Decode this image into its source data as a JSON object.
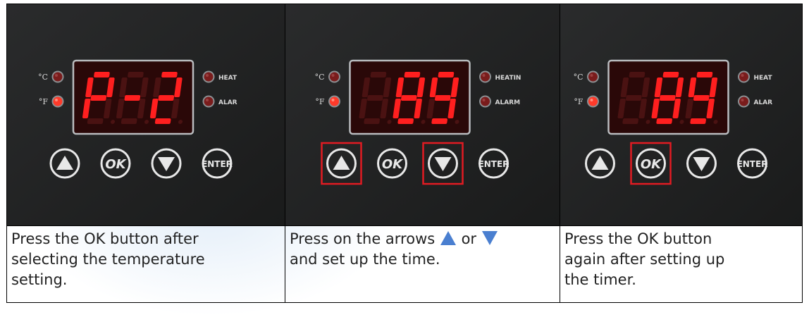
{
  "panels": [
    {
      "display": {
        "d1": "P",
        "d2": "-",
        "d3": "2",
        "d1_lit": true
      },
      "leds": {
        "celsius_label": "°C",
        "fahrenheit_label": "°F",
        "heating_label": "HEAT",
        "alarm_label": "ALAR"
      },
      "buttons": {
        "ok_label": "OK",
        "enter_label": "ENTER"
      },
      "highlight": []
    },
    {
      "display": {
        "d1": "8",
        "d2": "8",
        "d3": "9",
        "d1_lit": false
      },
      "leds": {
        "celsius_label": "°C",
        "fahrenheit_label": "°F",
        "heating_label": "HEATIN",
        "alarm_label": "ALARM"
      },
      "buttons": {
        "ok_label": "OK",
        "enter_label": "ENTER"
      },
      "highlight": [
        "up",
        "down"
      ]
    },
    {
      "display": {
        "d1": "8",
        "d2": "8",
        "d3": "9",
        "d1_lit": false
      },
      "leds": {
        "celsius_label": "°C",
        "fahrenheit_label": "°F",
        "heating_label": "HEAT",
        "alarm_label": "ALAR"
      },
      "buttons": {
        "ok_label": "OK",
        "enter_label": "ENTER"
      },
      "highlight": [
        "ok"
      ]
    }
  ],
  "captions": {
    "step1_line1": "Press the OK button after",
    "step1_line2": "selecting the temperature",
    "step1_line3": "setting.",
    "step2_part1": "Press on the arrows",
    "step2_part2": "or",
    "step2_line2": "and set up the time.",
    "step3_line1": "Press the OK button",
    "step3_line2": "again after setting up",
    "step3_line3": "the timer."
  },
  "colors": {
    "panel_bg": "#1f2020",
    "segment_lit": "#ff1f1f",
    "segment_dim": "#4a1212",
    "highlight_box": "#e11b22",
    "arrow_blue": "#4a7fd0"
  }
}
